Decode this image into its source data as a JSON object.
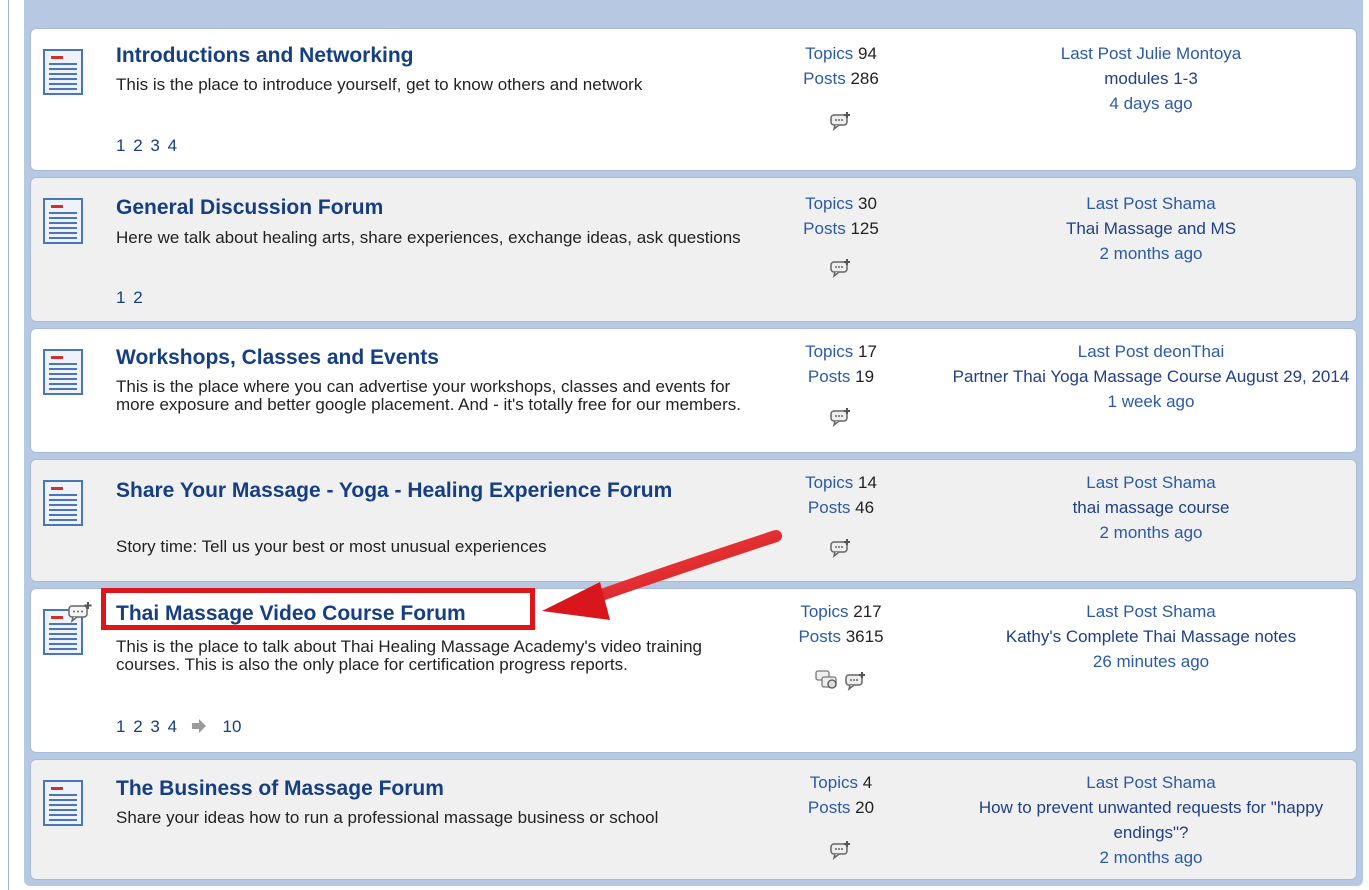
{
  "forums": [
    {
      "title": "Introductions and Networking",
      "description": "This is the place to introduce yourself, get to know others and network",
      "pages": [
        "1",
        "2",
        "3",
        "4"
      ],
      "topics_label": "Topics",
      "topics": "94",
      "posts_label": "Posts",
      "posts": "286",
      "last_post_label": "Last Post",
      "last_post_user": "Julie Montoya",
      "last_post_topic": "modules 1-3",
      "last_post_time": "4 days ago"
    },
    {
      "title": "General Discussion Forum",
      "description": "Here we talk about healing arts, share experiences, exchange ideas, ask questions",
      "pages": [
        "1",
        "2"
      ],
      "topics_label": "Topics",
      "topics": "30",
      "posts_label": "Posts",
      "posts": "125",
      "last_post_label": "Last Post",
      "last_post_user": "Shama",
      "last_post_topic": "Thai Massage and MS",
      "last_post_time": "2 months ago"
    },
    {
      "title": "Workshops, Classes and Events",
      "description": "This is the place where you can advertise your workshops, classes and events for more exposure and better google placement. And - it's totally free for our members.",
      "pages": [],
      "topics_label": "Topics",
      "topics": "17",
      "posts_label": "Posts",
      "posts": "19",
      "last_post_label": "Last Post",
      "last_post_user": "deonThai",
      "last_post_topic": "Partner Thai Yoga Massage Course August 29, 2014",
      "last_post_time": "1 week ago"
    },
    {
      "title": "Share Your Massage - Yoga - Healing Experience Forum",
      "description": "Story time: Tell us your best or most unusual experiences",
      "pages": [],
      "topics_label": "Topics",
      "topics": "14",
      "posts_label": "Posts",
      "posts": "46",
      "last_post_label": "Last Post",
      "last_post_user": "Shama",
      "last_post_topic": "thai massage course",
      "last_post_time": "2 months ago"
    },
    {
      "title": "Thai Massage Video Course Forum",
      "description": "This is the place to talk about Thai Healing Massage Academy's video training courses. This is also the only place for certification progress reports.",
      "pages": [
        "1",
        "2",
        "3",
        "4"
      ],
      "pages_last": "10",
      "topics_label": "Topics",
      "topics": "217",
      "posts_label": "Posts",
      "posts": "3615",
      "last_post_label": "Last Post",
      "last_post_user": "Shama",
      "last_post_topic": "Kathy's Complete Thai Massage notes",
      "last_post_time": "26 minutes ago"
    },
    {
      "title": "The Business of Massage Forum",
      "description": "Share your ideas how to run a professional massage business or school",
      "pages": [],
      "topics_label": "Topics",
      "topics": "4",
      "posts_label": "Posts",
      "posts": "20",
      "last_post_label": "Last Post",
      "last_post_user": "Shama",
      "last_post_topic": "How to prevent unwanted requests for \"happy endings\"?",
      "last_post_time": "2 months ago"
    }
  ],
  "colors": {
    "title": "#153e83",
    "link": "#2b5aa7",
    "annotation": "#e0151b",
    "row_border": "#a6bbd9",
    "frame": "#b7c9e2"
  },
  "icons": {
    "forum": "document-icon",
    "new_post": "new-post-icon",
    "multi_post": "multi-post-icon",
    "page_arrow": "arrow-right-icon"
  }
}
